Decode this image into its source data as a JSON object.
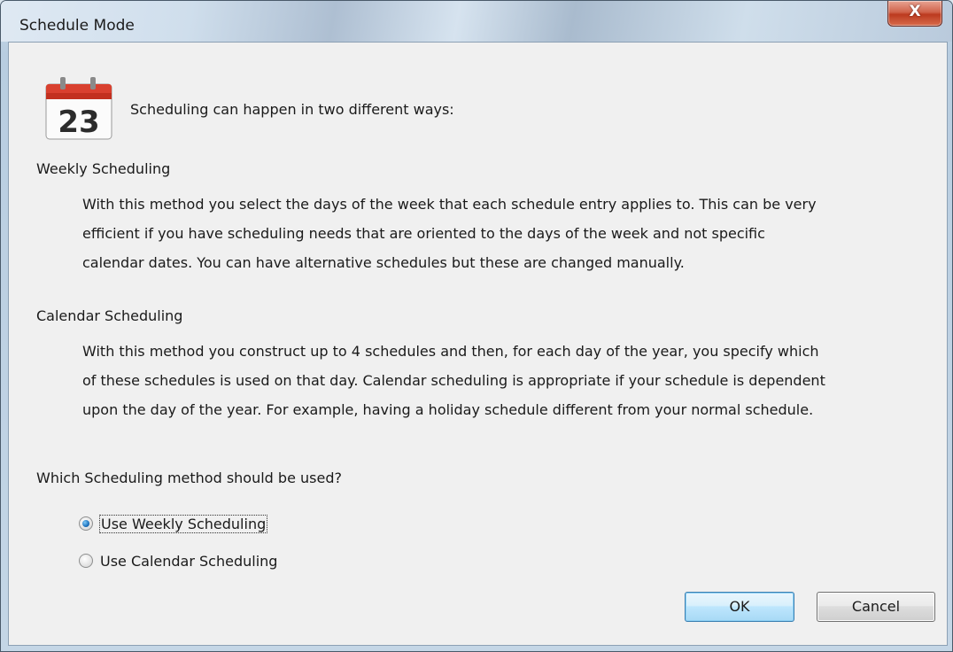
{
  "window": {
    "title": "Schedule Mode",
    "close_label": "X"
  },
  "icon": {
    "name": "calendar-icon",
    "day_number": "23",
    "accent_color": "#d9402f"
  },
  "intro_text": "Scheduling can happen in two different ways:",
  "sections": [
    {
      "heading": "Weekly Scheduling",
      "lines": [
        "With this method you select the days of the week that each schedule entry applies to.  This can be very",
        "efficient if you have scheduling needs that are oriented to the days of the week and not specific",
        "calendar dates.  You can have alternative schedules but these are changed manually."
      ]
    },
    {
      "heading": "Calendar Scheduling",
      "lines": [
        "With this method you construct up to 4 schedules and then, for each day of the year, you specify which",
        "of these schedules is used on that day. Calendar scheduling is appropriate if your schedule is dependent",
        "upon the day of the year. For example, having a holiday schedule different from your normal schedule."
      ]
    }
  ],
  "question": "Which Scheduling method should be used?",
  "options": [
    {
      "label": "Use Weekly Scheduling",
      "selected": true
    },
    {
      "label": "Use Calendar Scheduling",
      "selected": false
    }
  ],
  "buttons": {
    "ok_label": "OK",
    "cancel_label": "Cancel"
  }
}
